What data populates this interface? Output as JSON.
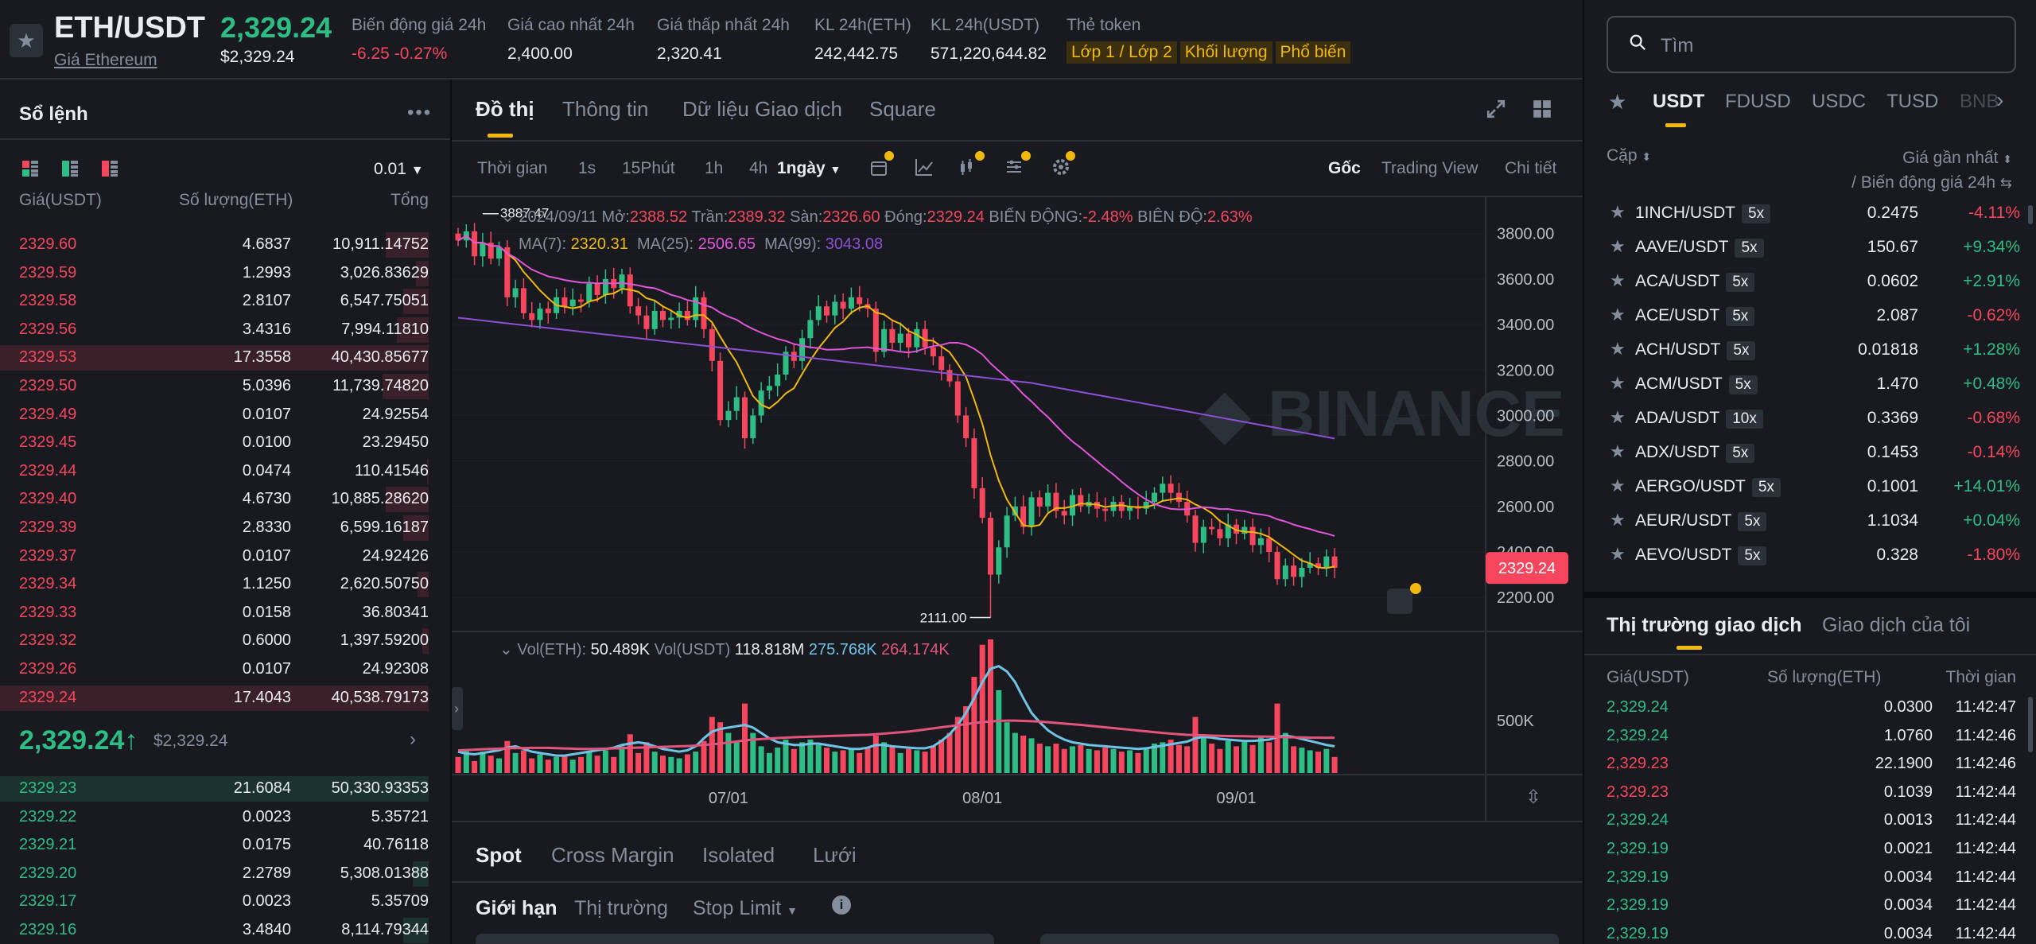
{
  "header": {
    "pair": "ETH/USDT",
    "pair_sub": "Giá Ethereum",
    "last_price": "2,329.24",
    "last_price_usd": "$2,329.24",
    "stats": [
      {
        "label": "Biến động giá 24h",
        "value": "-6.25 -0.27%",
        "color": "red"
      },
      {
        "label": "Giá cao nhất 24h",
        "value": "2,400.00",
        "color": "white"
      },
      {
        "label": "Giá thấp nhất 24h",
        "value": "2,320.41",
        "color": "white"
      },
      {
        "label": "KL 24h(ETH)",
        "value": "242,442.75",
        "color": "white"
      },
      {
        "label": "KL 24h(USDT)",
        "value": "571,220,644.82",
        "color": "white"
      }
    ],
    "token_tags_label": "Thẻ token",
    "token_tags": [
      "Lớp 1 / Lớp 2",
      "Khối lượng",
      "Phổ biến"
    ]
  },
  "search": {
    "placeholder": "Tìm"
  },
  "orderbook": {
    "title": "Sổ lệnh",
    "precision": "0.01",
    "headers": [
      "Giá(USDT)",
      "Số lượng(ETH)",
      "Tổng"
    ],
    "asks": [
      {
        "price": "2329.60",
        "qty": "4.6837",
        "total": "10,911.14752",
        "depth": 0.27
      },
      {
        "price": "2329.59",
        "qty": "1.2993",
        "total": "3,026.83629",
        "depth": 0.08
      },
      {
        "price": "2329.58",
        "qty": "2.8107",
        "total": "6,547.75051",
        "depth": 0.16
      },
      {
        "price": "2329.56",
        "qty": "3.4316",
        "total": "7,994.11810",
        "depth": 0.2
      },
      {
        "price": "2329.53",
        "qty": "17.3558",
        "total": "40,430.85677",
        "depth": 1.0
      },
      {
        "price": "2329.50",
        "qty": "5.0396",
        "total": "11,739.74820",
        "depth": 0.29
      },
      {
        "price": "2329.49",
        "qty": "0.0107",
        "total": "24.92554",
        "depth": 0.0
      },
      {
        "price": "2329.45",
        "qty": "0.0100",
        "total": "23.29450",
        "depth": 0.0
      },
      {
        "price": "2329.44",
        "qty": "0.0474",
        "total": "110.41546",
        "depth": 0.01
      },
      {
        "price": "2329.40",
        "qty": "4.6730",
        "total": "10,885.28620",
        "depth": 0.27
      },
      {
        "price": "2329.39",
        "qty": "2.8330",
        "total": "6,599.16187",
        "depth": 0.16
      },
      {
        "price": "2329.37",
        "qty": "0.0107",
        "total": "24.92426",
        "depth": 0.0
      },
      {
        "price": "2329.34",
        "qty": "1.1250",
        "total": "2,620.50750",
        "depth": 0.07
      },
      {
        "price": "2329.33",
        "qty": "0.0158",
        "total": "36.80341",
        "depth": 0.0
      },
      {
        "price": "2329.32",
        "qty": "0.6000",
        "total": "1,397.59200",
        "depth": 0.04
      },
      {
        "price": "2329.26",
        "qty": "0.0107",
        "total": "24.92308",
        "depth": 0.0
      },
      {
        "price": "2329.24",
        "qty": "17.4043",
        "total": "40,538.79173",
        "depth": 1.0
      }
    ],
    "mid_price": "2,329.24",
    "mid_arrow": "↑",
    "mid_usd": "$2,329.24",
    "bids": [
      {
        "price": "2329.23",
        "qty": "21.6084",
        "total": "50,330.93353",
        "depth": 1.0
      },
      {
        "price": "2329.22",
        "qty": "0.0023",
        "total": "5.35721",
        "depth": 0.0
      },
      {
        "price": "2329.21",
        "qty": "0.0175",
        "total": "40.76118",
        "depth": 0.0
      },
      {
        "price": "2329.20",
        "qty": "2.2789",
        "total": "5,308.01388",
        "depth": 0.1
      },
      {
        "price": "2329.17",
        "qty": "0.0023",
        "total": "5.35709",
        "depth": 0.0
      },
      {
        "price": "2329.16",
        "qty": "3.4840",
        "total": "8,114.79344",
        "depth": 0.16
      }
    ]
  },
  "chart_tabs": [
    "Đồ thị",
    "Thông tin",
    "Dữ liệu Giao dịch",
    "Square"
  ],
  "toolbar": {
    "time_label": "Thời gian",
    "intervals": [
      "1s",
      "15Phút",
      "1h",
      "4h"
    ],
    "active_interval": "1ngày",
    "views": [
      "Gốc",
      "Trading View",
      "Chi tiết"
    ]
  },
  "chart_data": {
    "type": "candlestick",
    "ohlc_label": {
      "date": "2024/09/11",
      "open_label": "Mở:",
      "open": "2388.52",
      "high_label": "Trần:",
      "high": "2389.32",
      "low_label": "Sàn:",
      "low": "2326.60",
      "close_label": "Đóng:",
      "close": "2329.24",
      "change_label": "BIẾN ĐỘNG:",
      "change": "-2.48%",
      "amp_label": "BIÊN ĐỘ:",
      "amp": "2.63%"
    },
    "ma": [
      {
        "name": "MA(7):",
        "value": "2320.31",
        "color": "#f0b90b"
      },
      {
        "name": "MA(25):",
        "value": "2506.65",
        "color": "#e254d8"
      },
      {
        "name": "MA(99):",
        "value": "3043.08",
        "color": "#8e4fd6"
      }
    ],
    "y_ticks": [
      "3800.00",
      "3600.00",
      "3400.00",
      "3200.00",
      "3000.00",
      "2800.00",
      "2600.00",
      "2400.00",
      "2200.00"
    ],
    "y_tick_values": [
      3800,
      3600,
      3400,
      3200,
      3000,
      2800,
      2600,
      2400,
      2200
    ],
    "ylim": [
      2050,
      3960
    ],
    "x_ticks": [
      "07/01",
      "08/01",
      "09/01"
    ],
    "high_label": "3887.47",
    "low_label": "2111.00",
    "price_tag": "2329.24",
    "closes": [
      3770,
      3810,
      3700,
      3760,
      3690,
      3740,
      3520,
      3560,
      3450,
      3420,
      3470,
      3450,
      3520,
      3480,
      3510,
      3500,
      3580,
      3530,
      3600,
      3560,
      3620,
      3480,
      3440,
      3380,
      3460,
      3420,
      3430,
      3460,
      3420,
      3520,
      3380,
      3240,
      2980,
      3020,
      3080,
      2900,
      3000,
      3110,
      3130,
      3180,
      3280,
      3240,
      3340,
      3420,
      3480,
      3440,
      3500,
      3470,
      3520,
      3490,
      3470,
      3280,
      3380,
      3320,
      3360,
      3300,
      3380,
      3300,
      3260,
      3200,
      3150,
      3000,
      2900,
      2680,
      2550,
      2300,
      2420,
      2560,
      2600,
      2510,
      2640,
      2600,
      2660,
      2580,
      2560,
      2650,
      2600,
      2620,
      2590,
      2580,
      2620,
      2580,
      2600,
      2590,
      2620,
      2660,
      2700,
      2660,
      2620,
      2560,
      2440,
      2510,
      2500,
      2460,
      2520,
      2480,
      2510,
      2430,
      2460,
      2400,
      2280,
      2340,
      2290,
      2330,
      2350,
      2330,
      2380,
      2330
    ],
    "volume_label": {
      "vol_eth_label": "Vol(ETH):",
      "vol_eth": "50.489K",
      "vol_usdt_label": "Vol(USDT)",
      "vol_usdt": "118.818M",
      "vol_ma1": "275.768K",
      "vol_ma2": "264.174K"
    },
    "volume_tick": "500K",
    "volumes": [
      120,
      180,
      90,
      160,
      130,
      110,
      240,
      150,
      170,
      110,
      140,
      100,
      120,
      130,
      100,
      120,
      160,
      130,
      170,
      120,
      200,
      290,
      150,
      230,
      160,
      130,
      120,
      110,
      140,
      160,
      240,
      420,
      380,
      300,
      240,
      520,
      300,
      200,
      150,
      190,
      250,
      180,
      230,
      250,
      210,
      190,
      160,
      170,
      180,
      150,
      190,
      280,
      230,
      200,
      150,
      180,
      170,
      160,
      200,
      250,
      300,
      420,
      500,
      720,
      960,
      1000,
      620,
      380,
      300,
      280,
      260,
      220,
      200,
      220,
      180,
      200,
      210,
      180,
      170,
      190,
      180,
      160,
      170,
      150,
      180,
      220,
      230,
      250,
      210,
      200,
      420,
      290,
      220,
      180,
      240,
      200,
      240,
      210,
      280,
      230,
      520,
      300,
      200,
      190,
      170,
      160,
      180,
      120
    ],
    "vol_ma_a": [
      160,
      145,
      140,
      150,
      160,
      170,
      190,
      200,
      180,
      160,
      150,
      140,
      130,
      130,
      140,
      150,
      160,
      170,
      180,
      190,
      210,
      220,
      230,
      220,
      200,
      180,
      170,
      160,
      170,
      200,
      260,
      310,
      330,
      340,
      350,
      360,
      340,
      300,
      260,
      230,
      220,
      210,
      210,
      220,
      220,
      210,
      200,
      190,
      180,
      180,
      190,
      210,
      210,
      200,
      195,
      190,
      185,
      185,
      200,
      240,
      290,
      360,
      450,
      560,
      680,
      780,
      800,
      760,
      680,
      560,
      450,
      380,
      320,
      280,
      250,
      230,
      220,
      210,
      205,
      200,
      195,
      190,
      185,
      180,
      185,
      195,
      205,
      215,
      225,
      235,
      260,
      270,
      265,
      255,
      250,
      245,
      240,
      240,
      245,
      250,
      270,
      280,
      270,
      255,
      240,
      225,
      210,
      200
    ],
    "vol_ma_b": [
      170,
      172,
      175,
      178,
      180,
      182,
      185,
      186,
      187,
      188,
      188,
      188,
      186,
      184,
      182,
      180,
      180,
      181,
      182,
      184,
      186,
      188,
      190,
      192,
      194,
      196,
      198,
      200,
      202,
      205,
      210,
      215,
      220,
      228,
      236,
      244,
      250,
      254,
      258,
      262,
      265,
      268,
      270,
      272,
      274,
      276,
      278,
      280,
      282,
      284,
      286,
      290,
      295,
      300,
      305,
      310,
      318,
      326,
      334,
      342,
      350,
      358,
      366,
      374,
      380,
      386,
      390,
      392,
      392,
      390,
      388,
      385,
      380,
      375,
      370,
      365,
      360,
      354,
      348,
      342,
      336,
      330,
      324,
      318,
      312,
      306,
      300,
      295,
      290,
      286,
      284,
      282,
      280,
      278,
      277,
      276,
      275,
      274,
      273,
      272,
      270,
      268,
      267,
      266,
      265,
      265,
      264,
      264
    ]
  },
  "form": {
    "tabs": [
      "Spot",
      "Cross Margin",
      "Isolated",
      "Lưới"
    ],
    "order_types": [
      "Giới hạn",
      "Thị trường",
      "Stop Limit"
    ]
  },
  "markets": {
    "tabs": [
      "USDT",
      "FDUSD",
      "USDC",
      "TUSD",
      "BNB"
    ],
    "head_pair": "Cặp",
    "head_price": "Giá gần nhất",
    "head_change": "/ Biến động giá 24h",
    "rows": [
      {
        "pair": "1INCH/USDT",
        "lev": "5x",
        "price": "0.2475",
        "change": "-4.11%",
        "up": false
      },
      {
        "pair": "AAVE/USDT",
        "lev": "5x",
        "price": "150.67",
        "change": "+9.34%",
        "up": true
      },
      {
        "pair": "ACA/USDT",
        "lev": "5x",
        "price": "0.0602",
        "change": "+2.91%",
        "up": true
      },
      {
        "pair": "ACE/USDT",
        "lev": "5x",
        "price": "2.087",
        "change": "-0.62%",
        "up": false
      },
      {
        "pair": "ACH/USDT",
        "lev": "5x",
        "price": "0.01818",
        "change": "+1.28%",
        "up": true
      },
      {
        "pair": "ACM/USDT",
        "lev": "5x",
        "price": "1.470",
        "change": "+0.48%",
        "up": true
      },
      {
        "pair": "ADA/USDT",
        "lev": "10x",
        "price": "0.3369",
        "change": "-0.68%",
        "up": false
      },
      {
        "pair": "ADX/USDT",
        "lev": "5x",
        "price": "0.1453",
        "change": "-0.14%",
        "up": false
      },
      {
        "pair": "AERGO/USDT",
        "lev": "5x",
        "price": "0.1001",
        "change": "+14.01%",
        "up": true
      },
      {
        "pair": "AEUR/USDT",
        "lev": "5x",
        "price": "1.1034",
        "change": "+0.04%",
        "up": true
      },
      {
        "pair": "AEVO/USDT",
        "lev": "5x",
        "price": "0.328",
        "change": "-1.80%",
        "up": false
      }
    ]
  },
  "trades": {
    "tabs": [
      "Thị trường giao dịch",
      "Giao dịch của tôi"
    ],
    "headers": [
      "Giá(USDT)",
      "Số lượng(ETH)",
      "Thời gian"
    ],
    "rows": [
      {
        "price": "2,329.24",
        "qty": "0.0300",
        "time": "11:42:47",
        "up": true
      },
      {
        "price": "2,329.24",
        "qty": "1.0760",
        "time": "11:42:46",
        "up": true
      },
      {
        "price": "2,329.23",
        "qty": "22.1900",
        "time": "11:42:46",
        "up": false
      },
      {
        "price": "2,329.23",
        "qty": "0.1039",
        "time": "11:42:44",
        "up": false
      },
      {
        "price": "2,329.24",
        "qty": "0.0013",
        "time": "11:42:44",
        "up": true
      },
      {
        "price": "2,329.19",
        "qty": "0.0021",
        "time": "11:42:44",
        "up": true
      },
      {
        "price": "2,329.19",
        "qty": "0.0034",
        "time": "11:42:44",
        "up": true
      },
      {
        "price": "2,329.19",
        "qty": "0.0034",
        "time": "11:42:44",
        "up": true
      },
      {
        "price": "2,329.19",
        "qty": "0.0034",
        "time": "11:42:44",
        "up": true
      }
    ]
  },
  "colors": {
    "up": "#2ebd85",
    "down": "#f6465d",
    "accent": "#f0b90b",
    "bg": "#181a20"
  }
}
